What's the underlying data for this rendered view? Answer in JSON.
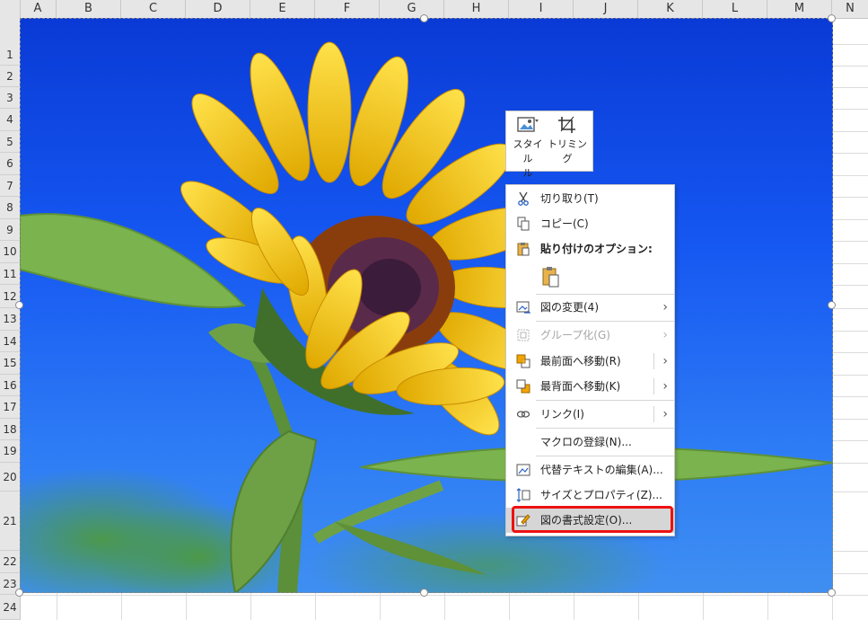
{
  "columns": [
    "A",
    "B",
    "C",
    "D",
    "E",
    "F",
    "G",
    "H",
    "I",
    "J",
    "K",
    "L",
    "M",
    "N"
  ],
  "rows": [
    "1",
    "2",
    "3",
    "4",
    "5",
    "6",
    "7",
    "8",
    "9",
    "10",
    "11",
    "12",
    "13",
    "14",
    "15",
    "16",
    "17",
    "18",
    "19",
    "20",
    "21",
    "22",
    "23",
    "24"
  ],
  "colors": {
    "highlight_box": "#ee1111",
    "menu_hover": "#d6d6d6",
    "sky": "#1658f2",
    "petal": "#f5c400"
  },
  "picture": {
    "subject-icon": "sunflower-image"
  },
  "mini_toolbar": {
    "style_label": "スタイル",
    "style_label_line2": "ル",
    "trim_label": "トリミング"
  },
  "context_menu": {
    "cut": "切り取り(T)",
    "copy": "コピー(C)",
    "paste_options": "貼り付けのオプション:",
    "change_picture": "図の変更(4)",
    "group": "グループ化(G)",
    "bring_front": "最前面へ移動(R)",
    "send_back": "最背面へ移動(K)",
    "link": "リンク(I)",
    "macro": "マクロの登録(N)...",
    "alt_text": "代替テキストの編集(A)...",
    "size_props": "サイズとプロパティ(Z)...",
    "format_picture": "図の書式設定(O)..."
  }
}
